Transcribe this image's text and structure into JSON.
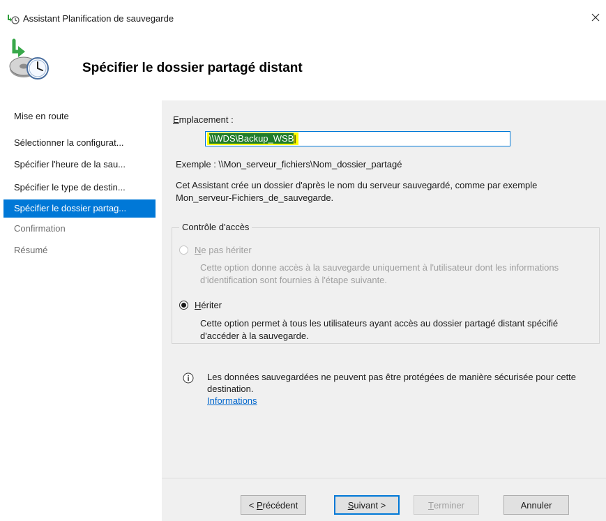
{
  "window": {
    "title": "Assistant Planification de sauvegarde",
    "close_icon": "close-icon"
  },
  "header": {
    "title": "Spécifier le dossier partagé distant",
    "icon": "backup-clock-icon"
  },
  "nav": {
    "items": [
      {
        "label": "Mise en route",
        "state": "normal"
      },
      {
        "label": "Sélectionner la configurat...",
        "state": "normal"
      },
      {
        "label": "Spécifier l'heure de la sau...",
        "state": "normal"
      },
      {
        "label": "Spécifier le type de destin...",
        "state": "normal"
      },
      {
        "label": "Spécifier le dossier partag...",
        "state": "active"
      },
      {
        "label": "Confirmation",
        "state": "disabled"
      },
      {
        "label": "Résumé",
        "state": "disabled"
      }
    ]
  },
  "location": {
    "label_first": "E",
    "label_rest": "mplacement :",
    "value_selected": "\\\\WDS\\Backup_WSB",
    "value_cursor": "|",
    "example": "Exemple : \\\\Mon_serveur_fichiers\\Nom_dossier_partagé",
    "assist_text": "Cet Assistant crée un dossier d'après le nom du serveur sauvegardé, comme par exemple Mon_serveur-Fichiers_de_sauvegarde."
  },
  "access_control": {
    "legend": "Contrôle d'accès",
    "no_inherit": {
      "label_first": "N",
      "label_rest": "e pas hériter",
      "description": "Cette option donne accès à la sauvegarde uniquement à l'utilisateur dont les informations d'identification sont fournies à l'étape suivante.",
      "enabled": false,
      "checked": false
    },
    "inherit": {
      "label_first": "H",
      "label_rest": "ériter",
      "description": "Cette option permet à tous les utilisateurs ayant accès au dossier partagé distant spécifié d'accéder à la sauvegarde.",
      "enabled": true,
      "checked": true
    }
  },
  "info": {
    "icon": "info-icon",
    "text": "Les données sauvegardées ne peuvent pas être protégées de manière sécurisée pour cette destination.",
    "link": "Informations"
  },
  "buttons": {
    "previous_prefix": "< ",
    "previous_first": "P",
    "previous_rest": "récédent",
    "next_first": "S",
    "next_rest": "uivant >",
    "finish_first": "T",
    "finish_rest": "erminer",
    "cancel": "Annuler"
  },
  "colors": {
    "accent": "#0078d7",
    "highlight": "#ffff00",
    "selection": "#1f7c2a",
    "panel": "#f0f0f0",
    "link": "#0066cc"
  }
}
